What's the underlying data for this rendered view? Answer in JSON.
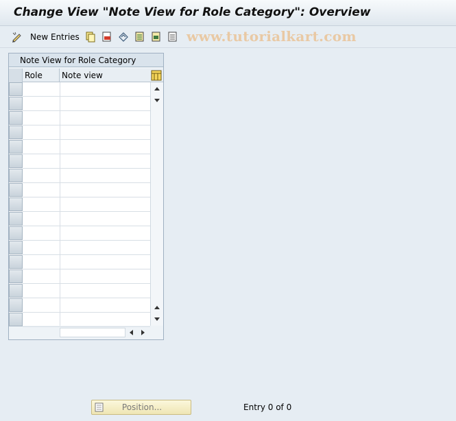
{
  "window": {
    "title": "Change View \"Note View for Role Category\": Overview"
  },
  "toolbar": {
    "new_entries_label": "New Entries",
    "icons": [
      "edit-pencil-icon",
      "copy-icon",
      "delete-icon",
      "undo-icon",
      "select-all-icon",
      "select-block-icon",
      "deselect-all-icon"
    ]
  },
  "watermark": "www.tutorialkart.com",
  "table": {
    "title": "Note View for Role Category",
    "columns": [
      "Role",
      "Note view"
    ],
    "rows": [
      {
        "role": "",
        "note_view": ""
      },
      {
        "role": "",
        "note_view": ""
      },
      {
        "role": "",
        "note_view": ""
      },
      {
        "role": "",
        "note_view": ""
      },
      {
        "role": "",
        "note_view": ""
      },
      {
        "role": "",
        "note_view": ""
      },
      {
        "role": "",
        "note_view": ""
      },
      {
        "role": "",
        "note_view": ""
      },
      {
        "role": "",
        "note_view": ""
      },
      {
        "role": "",
        "note_view": ""
      },
      {
        "role": "",
        "note_view": ""
      },
      {
        "role": "",
        "note_view": ""
      },
      {
        "role": "",
        "note_view": ""
      },
      {
        "role": "",
        "note_view": ""
      },
      {
        "role": "",
        "note_view": ""
      },
      {
        "role": "",
        "note_view": ""
      },
      {
        "role": "",
        "note_view": ""
      }
    ]
  },
  "footer": {
    "position_label": "Position...",
    "entry_status": "Entry 0 of 0"
  },
  "colors": {
    "background": "#e6edf3",
    "watermark": "#e9c9a4",
    "position_button": "#f5efc8"
  }
}
